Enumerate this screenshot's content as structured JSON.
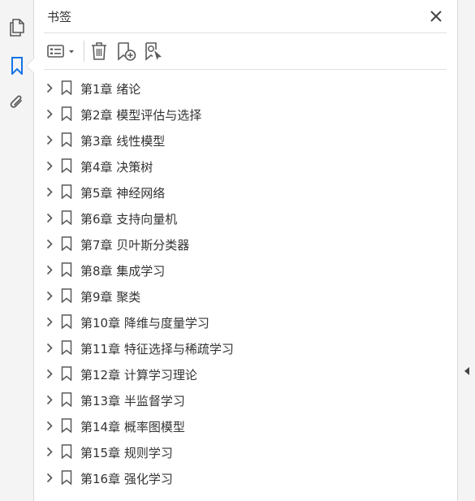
{
  "panel": {
    "title": "书签"
  },
  "left_rail": {
    "buttons": [
      {
        "icon": "pages-icon"
      },
      {
        "icon": "bookmark-icon",
        "active": true,
        "accent": "#1473e6"
      },
      {
        "icon": "attachment-icon"
      }
    ]
  },
  "toolbar": {
    "buttons": [
      "options-menu-icon",
      "delete-icon",
      "new-bookmark-icon",
      "bookmark-from-selection-icon"
    ]
  },
  "bookmarks": [
    {
      "label": "第1章  绪论"
    },
    {
      "label": "第2章  模型评估与选择"
    },
    {
      "label": "第3章  线性模型"
    },
    {
      "label": "第4章  决策树"
    },
    {
      "label": "第5章  神经网络"
    },
    {
      "label": "第6章  支持向量机"
    },
    {
      "label": "第7章  贝叶斯分类器"
    },
    {
      "label": "第8章  集成学习"
    },
    {
      "label": "第9章  聚类"
    },
    {
      "label": "第10章  降维与度量学习"
    },
    {
      "label": "第11章  特征选择与稀疏学习"
    },
    {
      "label": "第12章  计算学习理论"
    },
    {
      "label": "第13章  半监督学习"
    },
    {
      "label": "第14章  概率图模型"
    },
    {
      "label": "第15章  规则学习"
    },
    {
      "label": "第16章  强化学习"
    }
  ],
  "colors": {
    "accent": "#1473e6",
    "icon": "#5a5a5a",
    "text": "#333333",
    "rail_bg": "#f4f4f4"
  }
}
